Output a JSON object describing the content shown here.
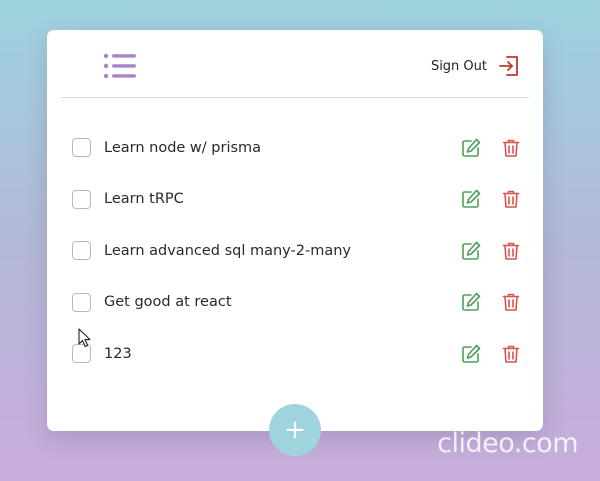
{
  "header": {
    "menu_icon": "list-icon",
    "signout_label": "Sign Out",
    "signout_icon": "sign-out-icon"
  },
  "todos": [
    {
      "label": "Learn node w/ prisma",
      "checked": false
    },
    {
      "label": "Learn tRPC",
      "checked": false
    },
    {
      "label": "Learn advanced sql many-2-many",
      "checked": false
    },
    {
      "label": "Get good at react",
      "checked": false
    },
    {
      "label": "123",
      "checked": false
    }
  ],
  "actions": {
    "edit_icon": "edit-icon",
    "delete_icon": "trash-icon",
    "add_icon": "plus-icon",
    "add_symbol": "+"
  },
  "watermark": "clideo.com",
  "colors": {
    "accent": "#a983c9",
    "edit": "#4aa25a",
    "delete": "#d9534f",
    "signout_icon": "#c0392b",
    "add_button": "#9fd4df"
  }
}
